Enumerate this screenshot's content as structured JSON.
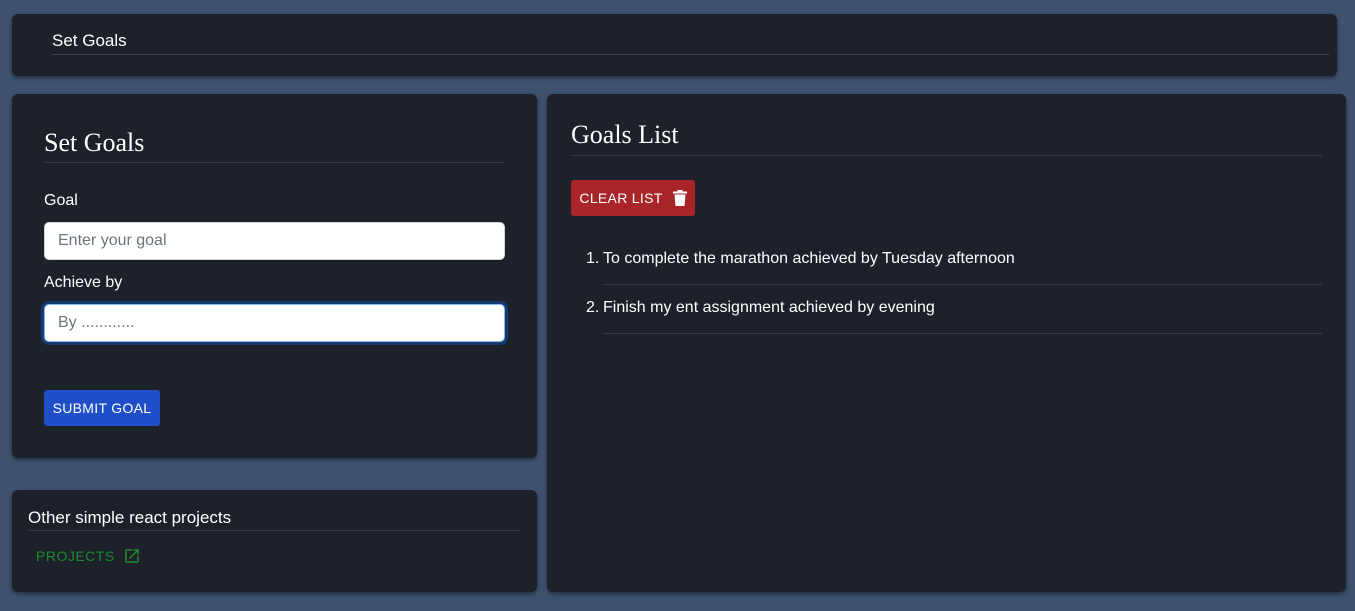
{
  "header": {
    "title": "Set Goals"
  },
  "form": {
    "title": "Set Goals",
    "goal_label": "Goal",
    "goal_placeholder": "Enter your goal",
    "goal_value": "",
    "achieve_label": "Achieve by",
    "achieve_placeholder": "By ............",
    "achieve_value": "",
    "submit_label": "SUBMIT GOAL"
  },
  "projects": {
    "title": "Other simple react projects",
    "link_label": "PROJECTS",
    "link_icon": "external-link-icon"
  },
  "goals": {
    "title": "Goals List",
    "clear_label": "CLEAR LIST",
    "clear_icon": "trash-icon",
    "items": [
      {
        "number": "1.",
        "text": "To complete the marathon achieved by Tuesday afternoon"
      },
      {
        "number": "2.",
        "text": "Finish my ent assignment achieved by evening"
      }
    ]
  },
  "colors": {
    "background": "#3e5270",
    "panel": "#1c212a",
    "submit": "#1e4fc9",
    "clear": "#a8262a",
    "link": "#1f8a2e"
  }
}
